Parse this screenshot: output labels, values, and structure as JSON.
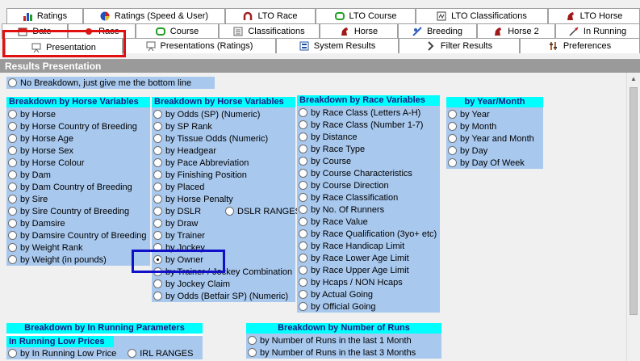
{
  "tabs": {
    "row1": [
      {
        "label": "Ratings",
        "icon": "bar-chart-icon"
      },
      {
        "label": "Ratings (Speed & User)",
        "icon": "pie-chart-icon"
      },
      {
        "label": "LTO Race",
        "icon": "horseshoe-icon"
      },
      {
        "label": "LTO Course",
        "icon": "racetrack-icon"
      },
      {
        "label": "LTO Classifications",
        "icon": "lto-icon"
      },
      {
        "label": "LTO Horse",
        "icon": "horse-icon"
      }
    ],
    "row2": [
      {
        "label": "Date",
        "icon": "calendar-icon"
      },
      {
        "label": "Race",
        "icon": "race-icon"
      },
      {
        "label": "Course",
        "icon": "course-icon"
      },
      {
        "label": "Classifications",
        "icon": "list-icon"
      },
      {
        "label": "Horse",
        "icon": "horse-icon"
      },
      {
        "label": "Breeding",
        "icon": "breeding-icon"
      },
      {
        "label": "Horse 2",
        "icon": "horse-icon"
      },
      {
        "label": "In Running",
        "icon": "running-icon"
      }
    ],
    "row3": [
      {
        "label": "Presentation",
        "icon": "presentation-icon"
      },
      {
        "label": "Presentations (Ratings)",
        "icon": "presentation-ratings-icon"
      },
      {
        "label": "System Results",
        "icon": "results-icon"
      },
      {
        "label": "Filter Results",
        "icon": "filter-icon"
      },
      {
        "label": "Preferences",
        "icon": "preferences-icon"
      }
    ]
  },
  "panel": {
    "title": "Results Presentation",
    "no_breakdown": "No Breakdown, just give me the bottom line",
    "horse_vars_1": {
      "title": "Breakdown by Horse Variables",
      "options": [
        "by Horse",
        "by Horse Country of Breeding",
        "by Horse Age",
        "by Horse Sex",
        "by Horse Colour",
        "by Dam",
        "by Dam Country of Breeding",
        "by Sire",
        "by Sire Country of Breeding",
        "by Damsire",
        "by Damsire Country of Breeding",
        "by Weight Rank",
        "by Weight (in pounds)"
      ]
    },
    "horse_vars_2": {
      "title": "Breakdown by Horse Variables",
      "options": [
        "by Odds (SP) (Numeric)",
        "by SP Rank",
        "by Tissue Odds (Numeric)",
        "by Headgear",
        "by Pace Abbreviation",
        "by Finishing Position",
        "by Placed",
        "by Horse Penalty",
        "by DSLR",
        "by Draw",
        "by Trainer",
        "by Jockey",
        "by Owner",
        "by Trainer / Jockey Combination",
        "by Jockey Claim",
        "by Odds (Betfair SP) (Numeric)"
      ],
      "dslr_ranges": "DSLR RANGES",
      "selected": "by Owner"
    },
    "race_vars": {
      "title": "Breakdown by Race Variables",
      "options": [
        "by Race Class (Letters A-H)",
        "by Race Class (Number 1-7)",
        "by Distance",
        "by Race Type",
        "by Course",
        "by Course Characteristics",
        "by Course Direction",
        "by Race Classification",
        "by No. Of Runners",
        "by Race Value",
        "by Race Qualification (3yo+ etc)",
        "by Race Handicap Limit",
        "by Race Lower Age Limit",
        "by Race Upper Age Limit",
        "by Hcaps / NON Hcaps",
        "by Actual Going",
        "by Official Going"
      ]
    },
    "year_month": {
      "title": "by Year/Month",
      "options": [
        "by Year",
        "by Month",
        "by Year and Month",
        "by Day",
        "by Day Of Week"
      ]
    },
    "in_running": {
      "title": "Breakdown by In Running Parameters",
      "subtitle": "In Running Low Prices",
      "option": "by In Running Low Price",
      "ranges": "IRL RANGES"
    },
    "runs": {
      "title": "Breakdown by Number of Runs",
      "options": [
        "by Number of Runs in the last 1 Month",
        "by Number of Runs in the last 3 Months"
      ]
    }
  },
  "colors": {
    "header_cyan": "#00ffff",
    "group_blue": "#a8c8ee",
    "title_gray": "#9a9a9a",
    "highlight_red": "#e01010",
    "highlight_blue": "#1010c8"
  }
}
